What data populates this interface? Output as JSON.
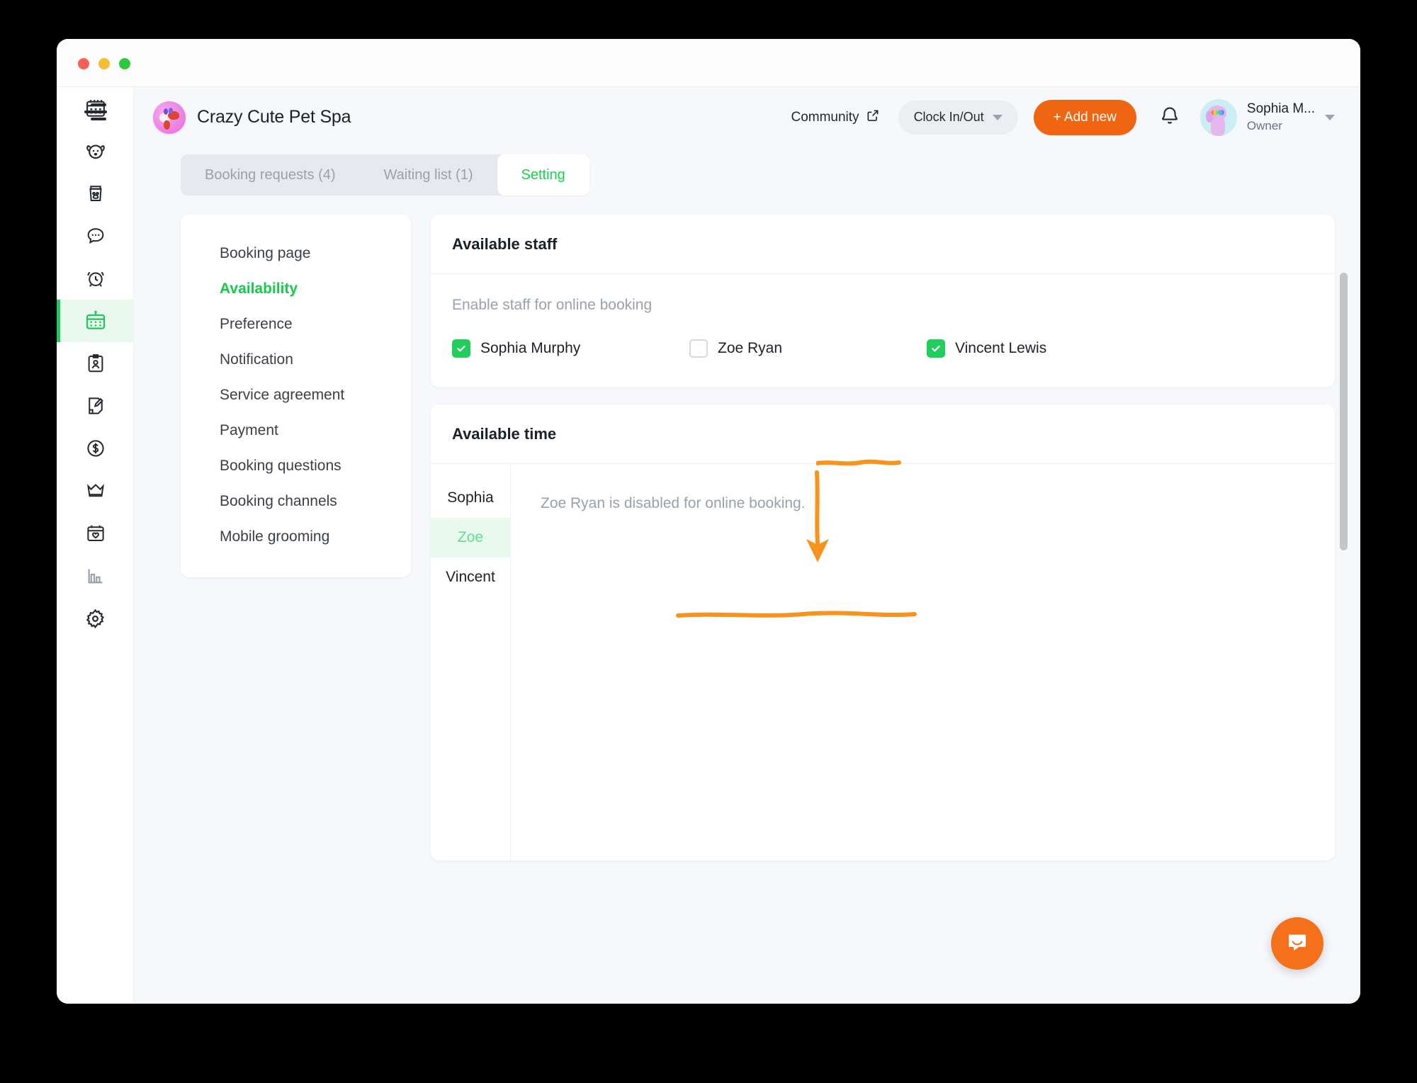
{
  "window": {
    "traffic_lights": [
      "close",
      "minimize",
      "maximize"
    ]
  },
  "header": {
    "brand_name": "Crazy Cute Pet Spa",
    "community_label": "Community",
    "clock_label": "Clock In/Out",
    "add_new_label": "+ Add new",
    "user_name": "Sophia M...",
    "user_role": "Owner",
    "colors": {
      "accent_orange": "#f06511",
      "accent_green": "#15d14b"
    }
  },
  "tabs": [
    {
      "label": "Booking requests (4)",
      "active": false
    },
    {
      "label": "Waiting list (1)",
      "active": false
    },
    {
      "label": "Setting",
      "active": true
    }
  ],
  "rail": {
    "items": [
      {
        "icon": "calendar-icon",
        "active": false
      },
      {
        "icon": "dog-face-icon",
        "active": false
      },
      {
        "icon": "pet-food-bag-icon",
        "active": false
      },
      {
        "icon": "chat-bubble-icon",
        "active": false
      },
      {
        "icon": "alarm-clock-icon",
        "active": false
      },
      {
        "icon": "online-booking-calendar-icon",
        "active": true
      },
      {
        "icon": "staff-clipboard-icon",
        "active": false
      },
      {
        "icon": "note-pencil-icon",
        "active": false
      },
      {
        "icon": "dollar-circle-icon",
        "active": false
      },
      {
        "icon": "crown-icon",
        "active": false
      },
      {
        "icon": "calendar-heart-icon",
        "active": false
      },
      {
        "icon": "bar-chart-icon",
        "active": false
      },
      {
        "icon": "gear-icon",
        "active": false
      }
    ]
  },
  "settings_nav": {
    "items": [
      {
        "label": "Booking page",
        "active": false
      },
      {
        "label": "Availability",
        "active": true
      },
      {
        "label": "Preference",
        "active": false
      },
      {
        "label": "Notification",
        "active": false
      },
      {
        "label": "Service agreement",
        "active": false
      },
      {
        "label": "Payment",
        "active": false
      },
      {
        "label": "Booking questions",
        "active": false
      },
      {
        "label": "Booking channels",
        "active": false
      },
      {
        "label": "Mobile grooming",
        "active": false
      }
    ]
  },
  "available_staff": {
    "title": "Available staff",
    "hint": "Enable staff for online booking",
    "staff": [
      {
        "name": "Sophia Murphy",
        "checked": true
      },
      {
        "name": "Zoe Ryan",
        "checked": false
      },
      {
        "name": "Vincent Lewis",
        "checked": true
      }
    ]
  },
  "available_time": {
    "title": "Available time",
    "tabs": [
      {
        "label": "Sophia",
        "active": false
      },
      {
        "label": "Zoe",
        "active": true
      },
      {
        "label": "Vincent",
        "active": false
      }
    ],
    "message": "Zoe Ryan is disabled for online booking."
  },
  "annotations": {
    "color": "#f7941d",
    "underline_staff": "underline-zoe-ryan-checkbox",
    "arrow": "arrow-pointing-down-to-available-time",
    "underline_message": "underline-disabled-message"
  },
  "widgets": {
    "intercom": "messenger-icon"
  }
}
